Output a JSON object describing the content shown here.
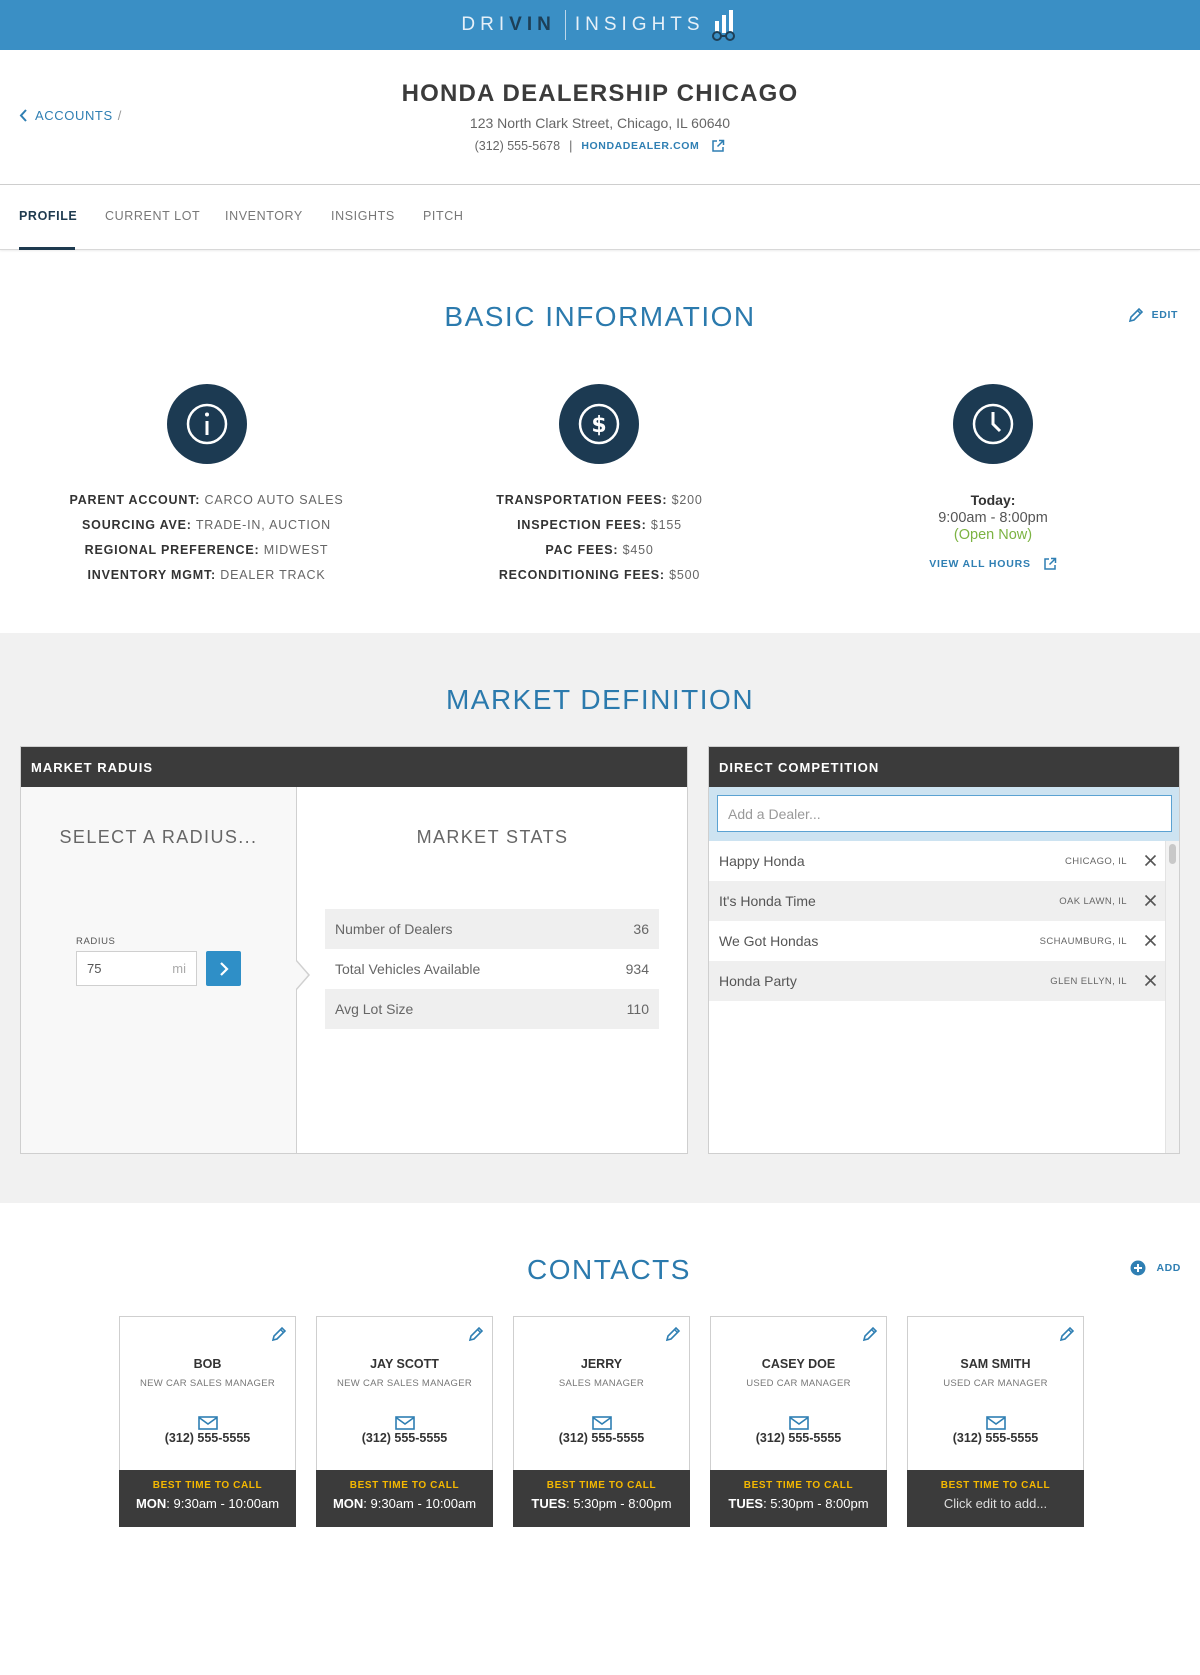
{
  "brand": {
    "part1_a": "DRI",
    "part1_b": "VIN",
    "part2": "INSIGHTS"
  },
  "breadcrumb": {
    "label": "ACCOUNTS",
    "separator": "/"
  },
  "dealer": {
    "name": "HONDA DEALERSHIP CHICAGO",
    "address": "123 North Clark Street, Chicago, IL 60640",
    "phone": "(312) 555-5678",
    "separator": "|",
    "website": "HONDADEALER.COM"
  },
  "tabs": [
    "PROFILE",
    "CURRENT LOT",
    "INVENTORY",
    "INSIGHTS",
    "PITCH"
  ],
  "active_tab": "PROFILE",
  "basic_info": {
    "title": "BASIC INFORMATION",
    "edit_label": "EDIT",
    "account": [
      {
        "key": "PARENT ACCOUNT:",
        "value": "CARCO AUTO SALES"
      },
      {
        "key": "SOURCING AVE:",
        "value": "TRADE-IN, AUCTION"
      },
      {
        "key": "REGIONAL PREFERENCE:",
        "value": "MIDWEST"
      },
      {
        "key": "INVENTORY MGMT:",
        "value": "DEALER TRACK"
      }
    ],
    "fees": [
      {
        "key": "TRANSPORTATION FEES:",
        "value": "$200"
      },
      {
        "key": "INSPECTION FEES:",
        "value": "$155"
      },
      {
        "key": "PAC FEES:",
        "value": "$450"
      },
      {
        "key": "RECONDITIONING FEES:",
        "value": "$500"
      }
    ],
    "hours": {
      "today_label": "Today:",
      "range": "9:00am - 8:00pm",
      "status": "(Open Now)",
      "view_all": "VIEW ALL HOURS"
    }
  },
  "market": {
    "title": "MARKET DEFINITION",
    "radius_panel": {
      "header": "MARKET RADUIS",
      "select_title": "SELECT A RADIUS...",
      "radius_label": "RADIUS",
      "radius_value": "75",
      "radius_unit": "mi",
      "stats_title": "MARKET STATS",
      "stats": [
        {
          "label": "Number of Dealers",
          "value": "36"
        },
        {
          "label": "Total Vehicles Available",
          "value": "934"
        },
        {
          "label": "Avg Lot Size",
          "value": "110"
        }
      ]
    },
    "competition": {
      "header": "DIRECT COMPETITION",
      "placeholder": "Add a Dealer...",
      "dealers": [
        {
          "name": "Happy Honda",
          "location": "CHICAGO, IL"
        },
        {
          "name": "It's Honda Time",
          "location": "OAK LAWN, IL"
        },
        {
          "name": "We Got Hondas",
          "location": "SCHAUMBURG, IL"
        },
        {
          "name": "Honda Party",
          "location": "GLEN ELLYN, IL"
        }
      ]
    }
  },
  "contacts": {
    "title": "CONTACTS",
    "add_label": "ADD",
    "best_time_label": "BEST TIME TO CALL",
    "items": [
      {
        "name": "BOB",
        "role": "NEW CAR SALES MANAGER",
        "phone": "(312) 555-5555",
        "day": "MON",
        "time": ": 9:30am - 10:00am"
      },
      {
        "name": "JAY SCOTT",
        "role": "NEW CAR SALES MANAGER",
        "phone": "(312) 555-5555",
        "day": "MON",
        "time": ": 9:30am - 10:00am"
      },
      {
        "name": "JERRY",
        "role": "SALES MANAGER",
        "phone": "(312) 555-5555",
        "day": "TUES",
        "time": ": 5:30pm - 8:00pm"
      },
      {
        "name": "CASEY DOE",
        "role": "USED CAR MANAGER",
        "phone": "(312) 555-5555",
        "day": "TUES",
        "time": ": 5:30pm - 8:00pm"
      },
      {
        "name": "SAM SMITH",
        "role": "USED CAR MANAGER",
        "phone": "(312) 555-5555",
        "empty_text": "Click edit to add..."
      }
    ]
  },
  "colors": {
    "topbar": "#3a8fc5",
    "accent": "#2b7aad",
    "navy": "#1c3a52",
    "dark": "#3b3b3b",
    "open_green": "#7cb342",
    "gold": "#f5b800"
  }
}
